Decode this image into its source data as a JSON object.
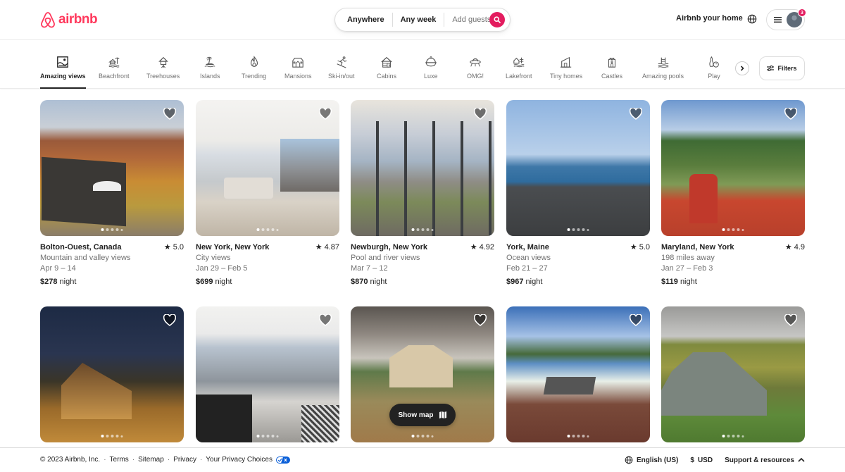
{
  "brand": {
    "name": "airbnb",
    "color": "#ff385c"
  },
  "search": {
    "anywhere": "Anywhere",
    "any_week": "Any week",
    "guests_placeholder": "Add guests",
    "button_color": "#e31c5f"
  },
  "header": {
    "host_link": "Airbnb your home",
    "notification_count": "3"
  },
  "categories": [
    {
      "label": "Amazing views",
      "icon": "amazing-views-icon",
      "active": true
    },
    {
      "label": "Beachfront",
      "icon": "beachfront-icon"
    },
    {
      "label": "Treehouses",
      "icon": "treehouse-icon"
    },
    {
      "label": "Islands",
      "icon": "island-icon"
    },
    {
      "label": "Trending",
      "icon": "flame-icon"
    },
    {
      "label": "Mansions",
      "icon": "mansion-icon"
    },
    {
      "label": "Ski-in/out",
      "icon": "skier-icon"
    },
    {
      "label": "Cabins",
      "icon": "cabin-icon"
    },
    {
      "label": "Luxe",
      "icon": "luxe-icon"
    },
    {
      "label": "OMG!",
      "icon": "ufo-icon"
    },
    {
      "label": "Lakefront",
      "icon": "lakefront-icon"
    },
    {
      "label": "Tiny homes",
      "icon": "tiny-home-icon"
    },
    {
      "label": "Castles",
      "icon": "castle-icon"
    },
    {
      "label": "Amazing pools",
      "icon": "pool-icon"
    },
    {
      "label": "Play",
      "icon": "bowling-icon"
    }
  ],
  "filters_label": "Filters",
  "listings": [
    {
      "location": "Bolton-Ouest, Canada",
      "rating": "5.0",
      "subtitle": "Mountain and valley views",
      "dates": "Apr 9 – 14",
      "price": "$278",
      "price_unit": "night"
    },
    {
      "location": "New York, New York",
      "rating": "4.87",
      "subtitle": "City views",
      "dates": "Jan 29 – Feb 5",
      "price": "$699",
      "price_unit": "night"
    },
    {
      "location": "Newburgh, New York",
      "rating": "4.92",
      "subtitle": "Pool and river views",
      "dates": "Mar 7 – 12",
      "price": "$870",
      "price_unit": "night"
    },
    {
      "location": "York, Maine",
      "rating": "5.0",
      "subtitle": "Ocean views",
      "dates": "Feb 21 – 27",
      "price": "$967",
      "price_unit": "night"
    },
    {
      "location": "Maryland, New York",
      "rating": "4.9",
      "subtitle": "198 miles away",
      "dates": "Jan 27 – Feb 3",
      "price": "$119",
      "price_unit": "night"
    }
  ],
  "show_map": "Show map",
  "footer": {
    "copyright": "© 2023 Airbnb, Inc.",
    "links": [
      "Terms",
      "Sitemap",
      "Privacy",
      "Your Privacy Choices"
    ],
    "language": "English (US)",
    "currency_symbol": "$",
    "currency": "USD",
    "support": "Support & resources"
  }
}
